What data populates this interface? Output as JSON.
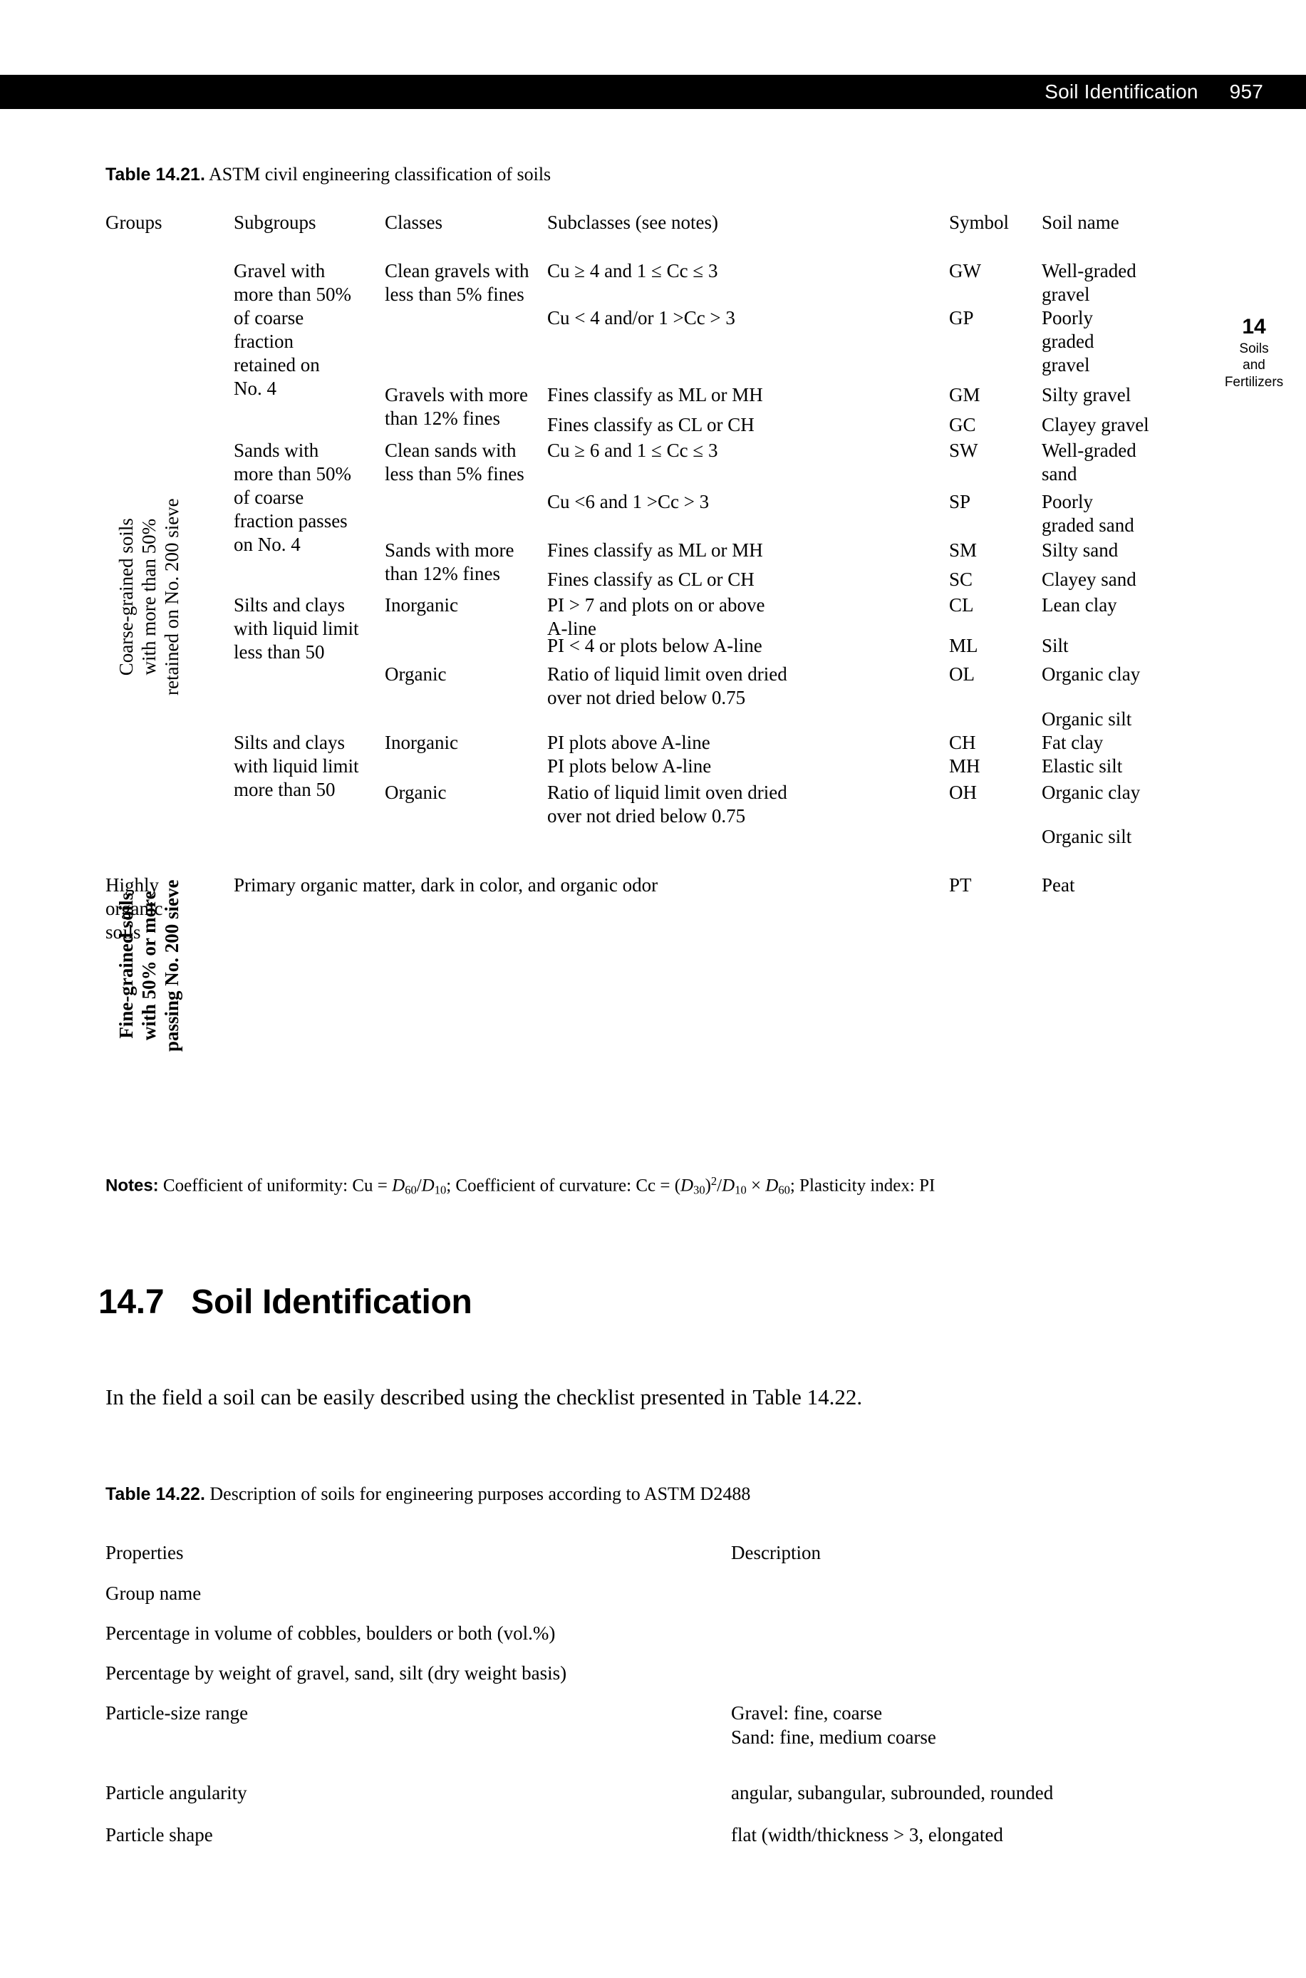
{
  "header": {
    "section_title": "Soil Identification",
    "page_number": "957"
  },
  "margin_tab": {
    "chapter_number": "14",
    "line1": "Soils",
    "line2": "and",
    "line3": "Fertilizers"
  },
  "table_14_21": {
    "caption_label": "Table 14.21.",
    "caption_text": "ASTM civil engineering classification of soils",
    "columns": {
      "groups": "Groups",
      "subgroups": "Subgroups",
      "classes": "Classes",
      "subclasses": "Subclasses (see notes)",
      "symbol": "Symbol",
      "soil_name": "Soil name"
    },
    "group_labels": {
      "coarse_l1": "Coarse-grained soils",
      "coarse_l2": "with more than 50%",
      "coarse_l3": "retained on No. 200 sieve",
      "fine_l1": "Fine-grained soils",
      "fine_l2": "with 50% or more",
      "fine_l3": "passing No. 200 sieve",
      "highly_organic": "Highly\norganic\nsoils"
    },
    "rows": [
      {
        "subgroup": "Gravel with\nmore than 50%\nof coarse\nfraction\nretained on\nNo. 4",
        "class": "Clean gravels with\nless than 5% fines",
        "subclass": "Cu ≥ 4 and 1 ≤ Cc ≤ 3",
        "symbol": "GW",
        "soil_name": "Well-graded\ngravel"
      },
      {
        "subgroup": "",
        "class": "",
        "subclass": "Cu < 4 and/or 1 >Cc > 3",
        "symbol": "GP",
        "soil_name": "Poorly\ngraded\ngravel"
      },
      {
        "subgroup": "",
        "class": "Gravels with more\nthan 12% fines",
        "subclass": "Fines classify as ML or MH",
        "symbol": "GM",
        "soil_name": "Silty gravel"
      },
      {
        "subgroup": "",
        "class": "",
        "subclass": "Fines classify as CL or CH",
        "symbol": "GC",
        "soil_name": "Clayey gravel"
      },
      {
        "subgroup": "Sands with\nmore than 50%\nof coarse\nfraction passes\non No. 4",
        "class": "Clean sands with\nless than 5% fines",
        "subclass": "Cu ≥ 6 and 1 ≤ Cc ≤ 3",
        "symbol": "SW",
        "soil_name": "Well-graded\nsand"
      },
      {
        "subgroup": "",
        "class": "",
        "subclass": "Cu <6 and 1 >Cc > 3",
        "symbol": "SP",
        "soil_name": "Poorly\ngraded sand"
      },
      {
        "subgroup": "",
        "class": "Sands with more\nthan 12% fines",
        "subclass": "Fines classify as ML or MH",
        "symbol": "SM",
        "soil_name": "Silty sand"
      },
      {
        "subgroup": "",
        "class": "",
        "subclass": "Fines classify as CL or CH",
        "symbol": "SC",
        "soil_name": "Clayey sand"
      },
      {
        "subgroup": "Silts and clays\nwith liquid limit\nless than 50",
        "class": "Inorganic",
        "subclass": "PI > 7 and plots on or above\nA-line",
        "symbol": "CL",
        "soil_name": "Lean clay"
      },
      {
        "subgroup": "",
        "class": "",
        "subclass": "PI < 4 or plots below A-line",
        "symbol": "ML",
        "soil_name": "Silt"
      },
      {
        "subgroup": "",
        "class": "Organic",
        "subclass": "Ratio of liquid limit oven dried\nover not dried below 0.75",
        "symbol": "OL",
        "soil_name": "Organic clay"
      },
      {
        "subgroup": "",
        "class": "",
        "subclass": "",
        "symbol": "",
        "soil_name": "Organic silt"
      },
      {
        "subgroup": "Silts and clays\nwith liquid limit\nmore than 50",
        "class": "Inorganic",
        "subclass": "PI plots above A-line",
        "symbol": "CH",
        "soil_name": "Fat clay"
      },
      {
        "subgroup": "",
        "class": "",
        "subclass": "PI plots below A-line",
        "symbol": "MH",
        "soil_name": "Elastic silt"
      },
      {
        "subgroup": "",
        "class": "Organic",
        "subclass": "Ratio of liquid limit oven dried\nover not dried below 0.75",
        "symbol": "OH",
        "soil_name": "Organic clay"
      },
      {
        "subgroup": "",
        "class": "",
        "subclass": "",
        "symbol": "",
        "soil_name": "Organic silt"
      }
    ],
    "peat_row": {
      "description": "Primary organic matter, dark in color, and organic odor",
      "symbol": "PT",
      "soil_name": "Peat"
    },
    "notes": {
      "label": "Notes:",
      "part1": "Coefficient of uniformity: Cu = ",
      "d60": "D",
      "sub60": "60",
      "slash": "/",
      "d10a": "D",
      "sub10a": "10",
      "part2": "; Coefficient of curvature: Cc = (",
      "d30": "D",
      "sub30": "30",
      "paren_sup": ")",
      "sup2": "2",
      "slash2": "/",
      "d10b": "D",
      "sub10b": "10",
      "times": " × ",
      "d60b": "D",
      "sub60b": "60",
      "part3": "; Plasticity index: PI"
    }
  },
  "section": {
    "number": "14.7",
    "title": "Soil Identification",
    "paragraph": "In the field a soil can be easily described using the checklist presented in Table 14.22."
  },
  "table_14_22": {
    "caption_label": "Table 14.22.",
    "caption_text": "Description of soils for engineering purposes according to ASTM D2488",
    "columns": {
      "properties": "Properties",
      "description": "Description"
    },
    "rows": [
      {
        "property": "Group name",
        "description": ""
      },
      {
        "property": "Percentage in volume of cobbles, boulders or both (vol.%)",
        "description": ""
      },
      {
        "property": "Percentage by weight of gravel, sand, silt (dry weight basis)",
        "description": ""
      },
      {
        "property": "Particle-size range",
        "description": "Gravel: fine, coarse\nSand: fine, medium coarse"
      },
      {
        "property": "Particle angularity",
        "description": "angular, subangular, subrounded, rounded"
      },
      {
        "property": "Particle shape",
        "description": "flat (width/thickness > 3, elongated"
      }
    ]
  }
}
